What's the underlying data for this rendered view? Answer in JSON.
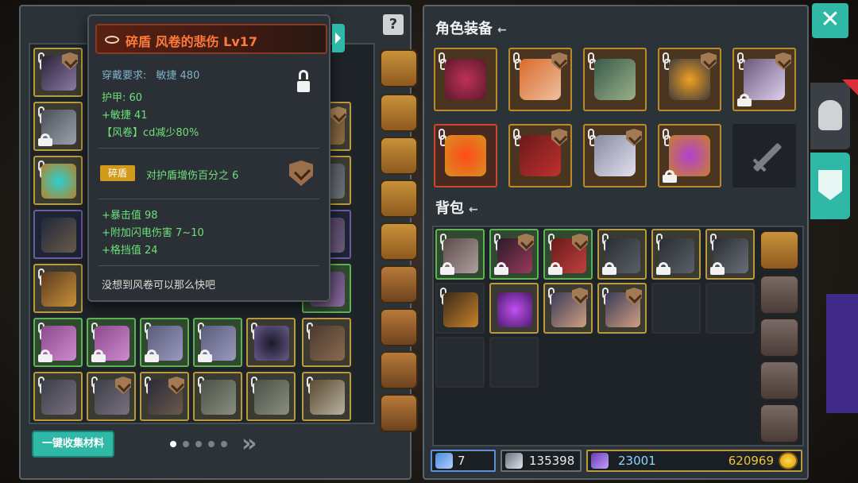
{
  "colors": {
    "accent_teal": "#2fb8a6",
    "title_orange": "#ff7a3a",
    "stat_green": "#6ee07a",
    "req_blue": "#7fb0c8",
    "gold_border": "#b99a3f"
  },
  "tooltip": {
    "title": "碎盾 风卷的悲伤 Lv17",
    "requirement_label": "穿戴要求:",
    "requirement_value": "敏捷 480",
    "stats": [
      "护甲:  60",
      "+敏捷 41",
      "【风卷】cd减少80%"
    ],
    "tag": "碎盾",
    "tag_desc": "对护盾增伤百分之 6",
    "bonus_stats": [
      "+暴击值 98",
      "+附加闪电伤害 7~10",
      "+格挡值 24"
    ],
    "flavor": "没想到风卷可以那么快吧"
  },
  "left": {
    "help_icon": "question-icon",
    "collect_button": "一键收集材料",
    "page_dots": 5,
    "active_page": 1,
    "next_icon": "double-chevron-right-icon"
  },
  "right": {
    "equip_title": "角色装备",
    "bag_title": "背包",
    "back_glyph": "←"
  },
  "resources": {
    "wand": "7",
    "shield": "135398",
    "gem": "23001",
    "gold": "620969"
  },
  "close_glyph": "✕"
}
